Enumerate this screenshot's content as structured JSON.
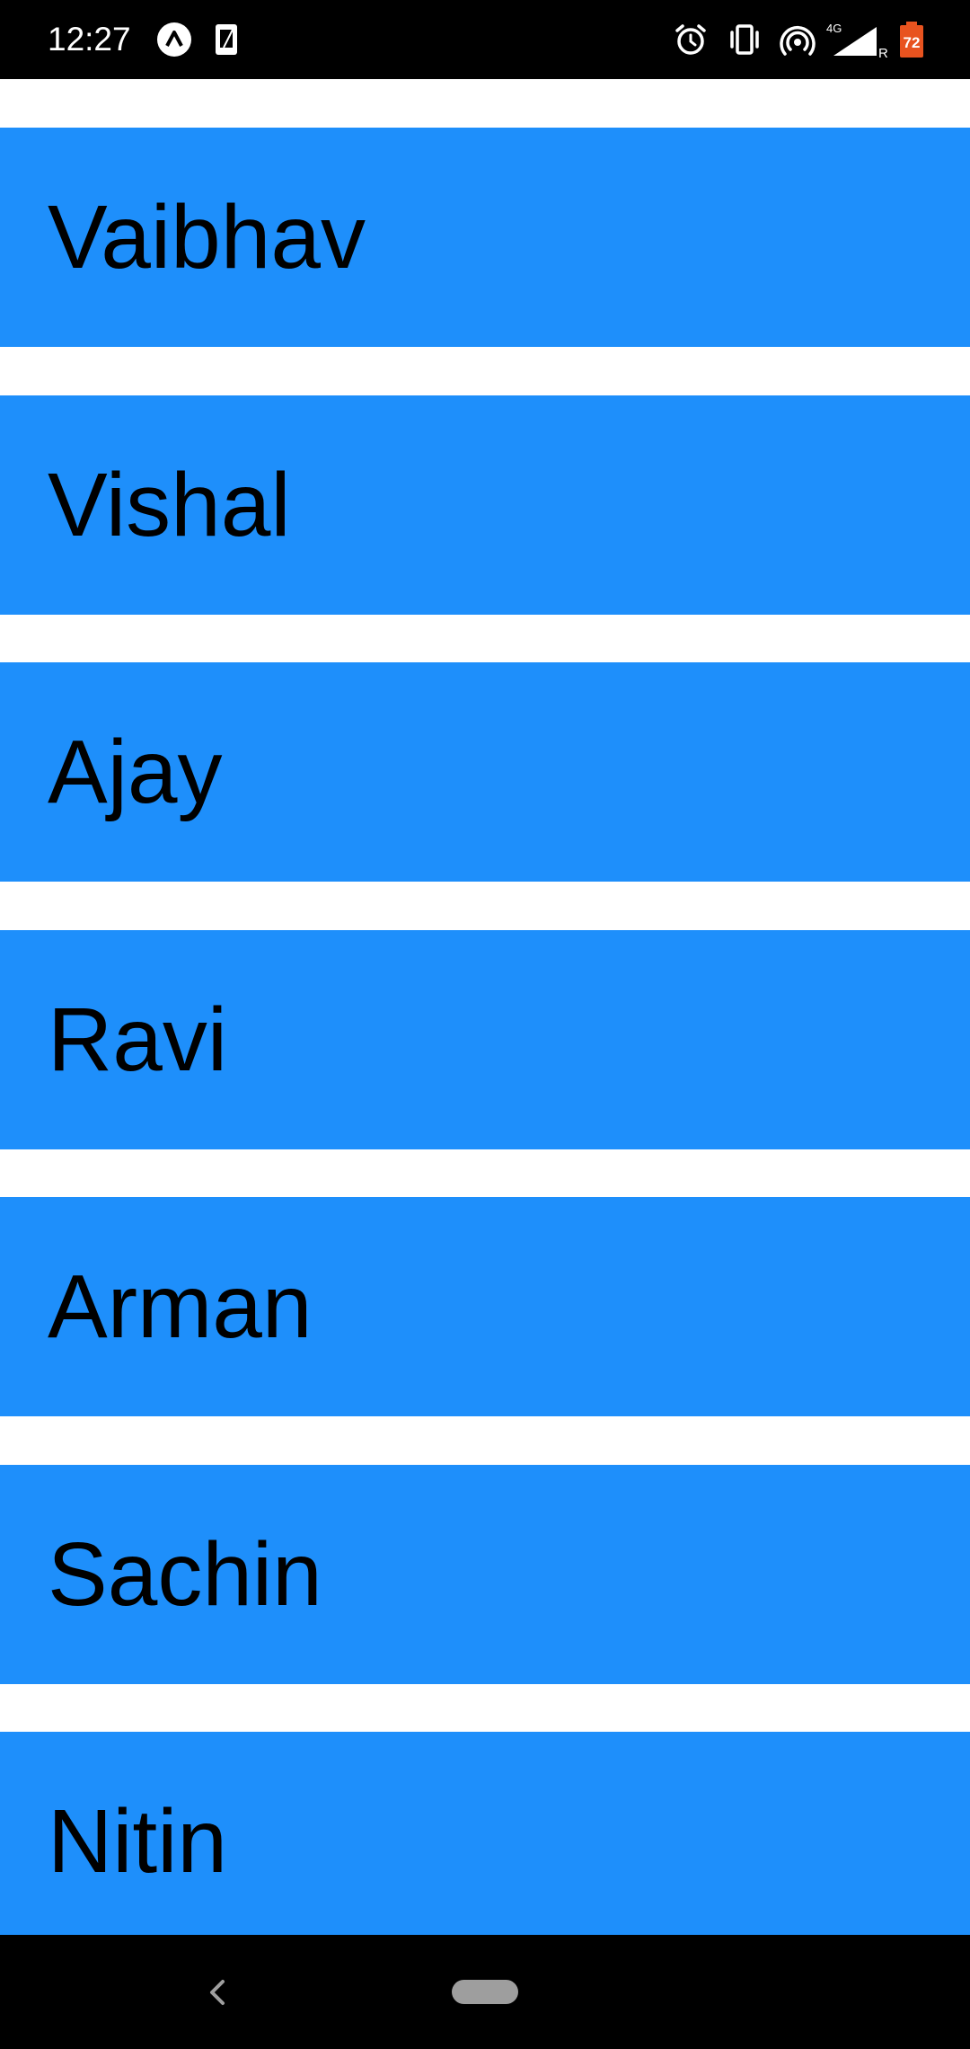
{
  "status_bar": {
    "time": "12:27",
    "battery": "72",
    "network": "4G",
    "roaming": "R",
    "icons": [
      "expo-notification-icon",
      "sim-card-icon",
      "alarm-icon",
      "vibrate-icon",
      "hotspot-icon",
      "cellular-signal-icon",
      "battery-icon"
    ]
  },
  "list": {
    "item_color": "#1e8ffb",
    "items": [
      {
        "label": "Vaibhav"
      },
      {
        "label": "Vishal"
      },
      {
        "label": "Ajay"
      },
      {
        "label": "Ravi"
      },
      {
        "label": "Arman"
      },
      {
        "label": "Sachin"
      },
      {
        "label": "Nitin"
      }
    ]
  },
  "nav_bar": {
    "icons": [
      "back-icon",
      "home-pill-icon"
    ]
  }
}
